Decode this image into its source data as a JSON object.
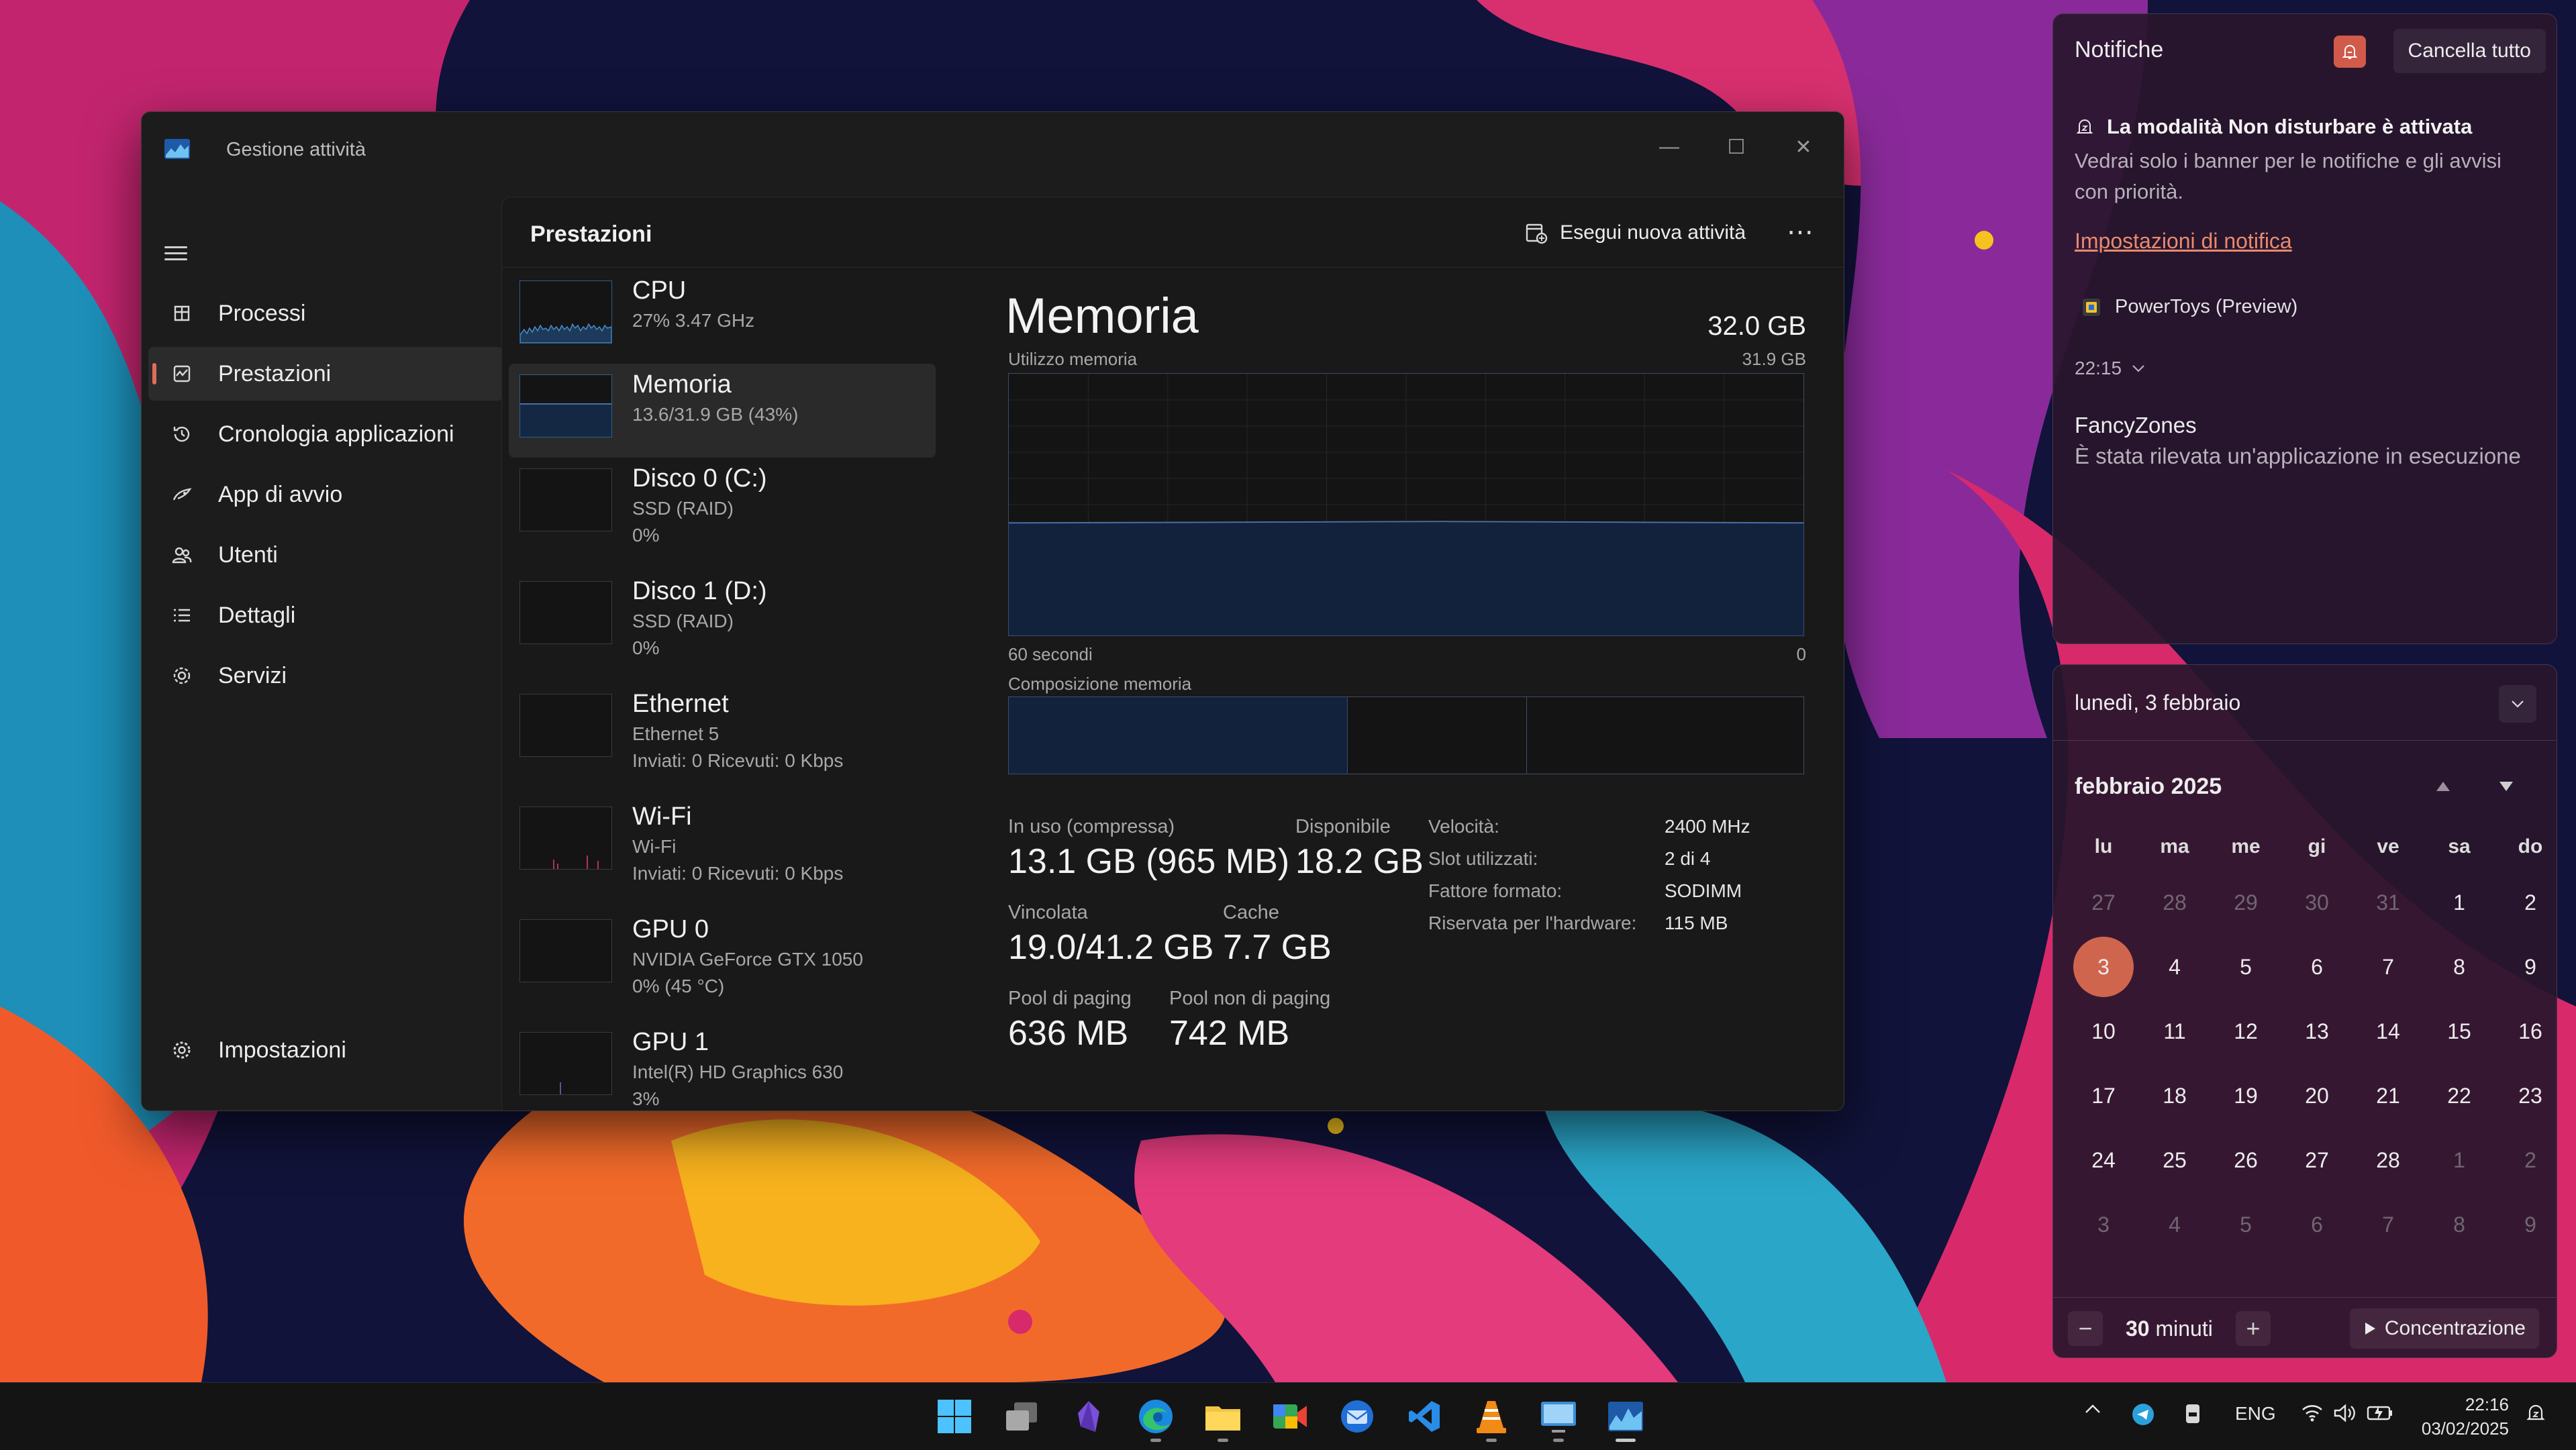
{
  "task_manager": {
    "title": "Gestione attività",
    "nav": [
      {
        "label": "Processi",
        "icon": "processes-icon"
      },
      {
        "label": "Prestazioni",
        "icon": "performance-icon",
        "active": true
      },
      {
        "label": "Cronologia applicazioni",
        "icon": "history-icon"
      },
      {
        "label": "App di avvio",
        "icon": "startup-apps-icon"
      },
      {
        "label": "Utenti",
        "icon": "users-icon"
      },
      {
        "label": "Dettagli",
        "icon": "details-icon"
      },
      {
        "label": "Servizi",
        "icon": "services-icon"
      }
    ],
    "settings_label": "Impostazioni",
    "page_title": "Prestazioni",
    "run_task_label": "Esegui nuova attività",
    "resources": [
      {
        "name": "CPU",
        "sub": "27% 3.47 GHz",
        "sub2": ""
      },
      {
        "name": "Memoria",
        "sub": "13.6/31.9 GB (43%)",
        "sub2": "",
        "selected": true
      },
      {
        "name": "Disco 0 (C:)",
        "sub": "SSD (RAID)",
        "sub2": "0%"
      },
      {
        "name": "Disco 1 (D:)",
        "sub": "SSD (RAID)",
        "sub2": "0%"
      },
      {
        "name": "Ethernet",
        "sub": "Ethernet 5",
        "sub2": "Inviati: 0 Ricevuti: 0 Kbps"
      },
      {
        "name": "Wi-Fi",
        "sub": "Wi-Fi",
        "sub2": "Inviati: 0 Ricevuti: 0 Kbps"
      },
      {
        "name": "GPU 0",
        "sub": "NVIDIA GeForce GTX 1050",
        "sub2": "0% (45 °C)"
      },
      {
        "name": "GPU 1",
        "sub": "Intel(R) HD Graphics 630",
        "sub2": "3%"
      }
    ],
    "memory": {
      "title": "Memoria",
      "total": "32.0 GB",
      "usage_label": "Utilizzo memoria",
      "usage_max": "31.9 GB",
      "x_left": "60 secondi",
      "x_right": "0",
      "usage_level": 0.43,
      "composition_label": "Composizione memoria",
      "composition": {
        "in_use": 0.41,
        "modified": 0.016,
        "standby": 0.225
      },
      "stats": {
        "in_use_label": "In uso (compressa)",
        "in_use": "13.1 GB (965 MB)",
        "available_label": "Disponibile",
        "available": "18.2 GB",
        "committed_label": "Vincolata",
        "committed": "19.0/41.2 GB",
        "cache_label": "Cache",
        "cache": "7.7 GB",
        "paged_label": "Pool di paging",
        "paged": "636 MB",
        "nonpaged_label": "Pool non di paging",
        "nonpaged": "742 MB"
      },
      "specs": [
        {
          "label": "Velocità:",
          "value": "2400 MHz"
        },
        {
          "label": "Slot utilizzati:",
          "value": "2 di 4"
        },
        {
          "label": "Fattore formato:",
          "value": "SODIMM"
        },
        {
          "label": "Riservata per l'hardware:",
          "value": "115 MB"
        }
      ]
    }
  },
  "notifications": {
    "title": "Notifiche",
    "clear_all": "Cancella tutto",
    "dnd_title": "La modalità Non disturbare è attivata",
    "dnd_body": "Vedrai solo i banner per le notifiche e gli avvisi con priorità.",
    "settings_link": "Impostazioni di notifica",
    "app_name": "PowerToys (Preview)",
    "time": "22:15",
    "toast_title": "FancyZones",
    "toast_body": "È stata rilevata un'applicazione in esecuzione"
  },
  "calendar": {
    "date_header": "lunedì, 3 febbraio",
    "month": "febbraio 2025",
    "weekdays": [
      "lu",
      "ma",
      "me",
      "gi",
      "ve",
      "sa",
      "do"
    ],
    "weeks": [
      [
        "27",
        "28",
        "29",
        "30",
        "31",
        "1",
        "2"
      ],
      [
        "3",
        "4",
        "5",
        "6",
        "7",
        "8",
        "9"
      ],
      [
        "10",
        "11",
        "12",
        "13",
        "14",
        "15",
        "16"
      ],
      [
        "17",
        "18",
        "19",
        "20",
        "21",
        "22",
        "23"
      ],
      [
        "24",
        "25",
        "26",
        "27",
        "28",
        "1",
        "2"
      ],
      [
        "3",
        "4",
        "5",
        "6",
        "7",
        "8",
        "9"
      ]
    ],
    "today": "3",
    "focus_minutes": "30",
    "focus_unit": "minuti",
    "focus_button": "Concentrazione"
  },
  "taskbar": {
    "apps": [
      "start-icon",
      "task-view-icon",
      "obsidian-icon",
      "edge-icon",
      "file-explorer-icon",
      "meet-icon",
      "thunderbird-icon",
      "vscode-icon",
      "vlc-icon",
      "remote-desktop-icon",
      "task-manager-icon"
    ],
    "language": "ENG",
    "time": "22:16",
    "date": "03/02/2025"
  },
  "colors": {
    "accent": "#d0654e",
    "memory_line": "#4a6fa5",
    "panel_bg": "#28162c"
  }
}
